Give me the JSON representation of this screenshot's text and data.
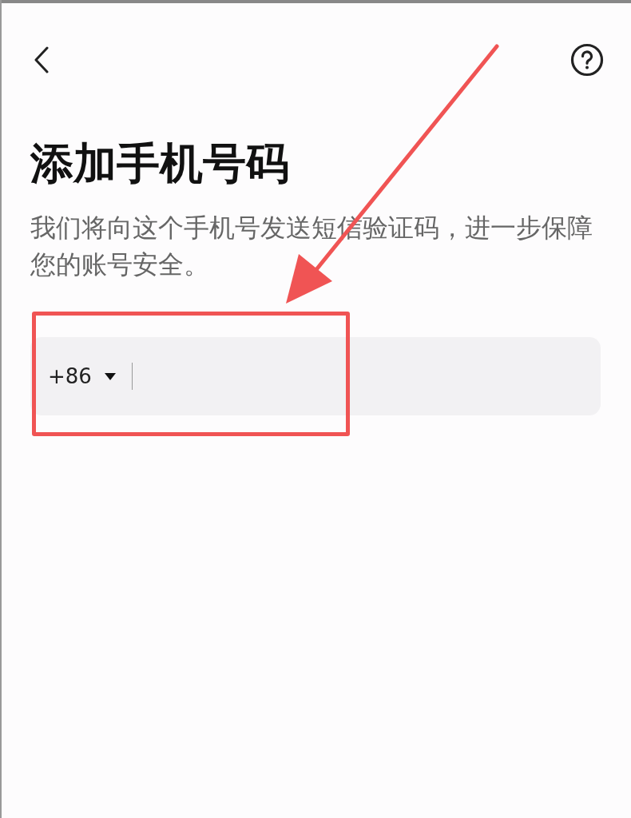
{
  "title": "添加手机号码",
  "description": "我们将向这个手机号发送短信验证码，进一步保障您的账号安全。",
  "phone_field": {
    "country_code": "+86"
  },
  "annotation_arrow": {
    "color": "#f05454"
  },
  "annotation_box": {
    "color": "#f05454"
  }
}
